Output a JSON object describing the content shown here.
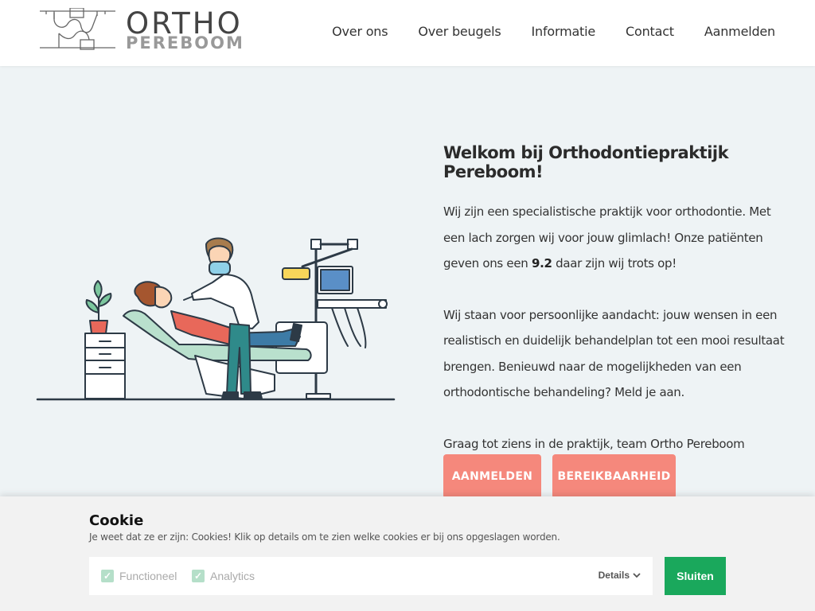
{
  "header": {
    "logo_line1": "ORTHO",
    "logo_line2": "PEREBOOM",
    "nav": [
      "Over ons",
      "Over beugels",
      "Informatie",
      "Contact",
      "Aanmelden"
    ]
  },
  "hero": {
    "title": "Welkom bij Orthodontiepraktijk Pereboom!",
    "p1_before": "Wij zijn een specialistische praktijk voor orthodontie. Met een lach zorgen wij voor jouw glimlach! Onze patiënten geven ons een ",
    "p1_score": "9.2",
    "p1_after": " daar zijn wij trots op!",
    "p2": "Wij staan voor persoonlijke aandacht: jouw wensen in een realistisch en duidelijk behandelplan tot een mooi resultaat brengen. Benieuwd naar de mogelijkheden van een orthodontische behandeling? Meld je aan.",
    "p3": "Graag tot ziens in de praktijk, team Ortho Pereboom",
    "btn_primary": "AANMELDEN",
    "btn_secondary": "BEREIKBAARHEID"
  },
  "cookie": {
    "title": "Cookie",
    "text": "Je weet dat ze er zijn: Cookies! Klik op details om te zien welke cookies er bij ons opgeslagen worden.",
    "options": [
      "Functioneel",
      "Analytics"
    ],
    "details_label": "Details",
    "close_label": "Sluiten"
  },
  "colors": {
    "accent": "#f5887c",
    "confirm": "#1aa85c",
    "background": "#eef3f5"
  }
}
